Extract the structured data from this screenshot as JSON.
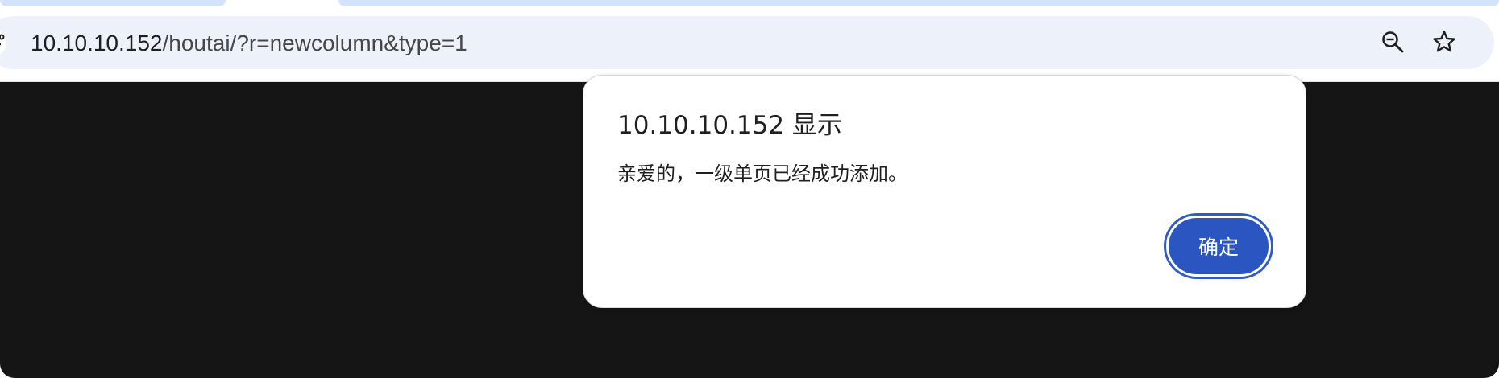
{
  "browser": {
    "address_bar": {
      "url_host": "10.10.10.152",
      "url_path": "/houtai/?r=newcolumn&type=1"
    },
    "icons": {
      "site_info": "tune-icon",
      "zoom": "zoom-out-icon",
      "bookmark": "star-icon"
    }
  },
  "dialog": {
    "title": "10.10.10.152 显示",
    "message": "亲爱的，一级单页已经成功添加。",
    "ok_label": "确定"
  },
  "colors": {
    "omnibox_bg": "#edf2fa",
    "tab_active": "#d3e3fd",
    "overlay_bg": "#151515",
    "button_primary": "#2b55c0"
  }
}
